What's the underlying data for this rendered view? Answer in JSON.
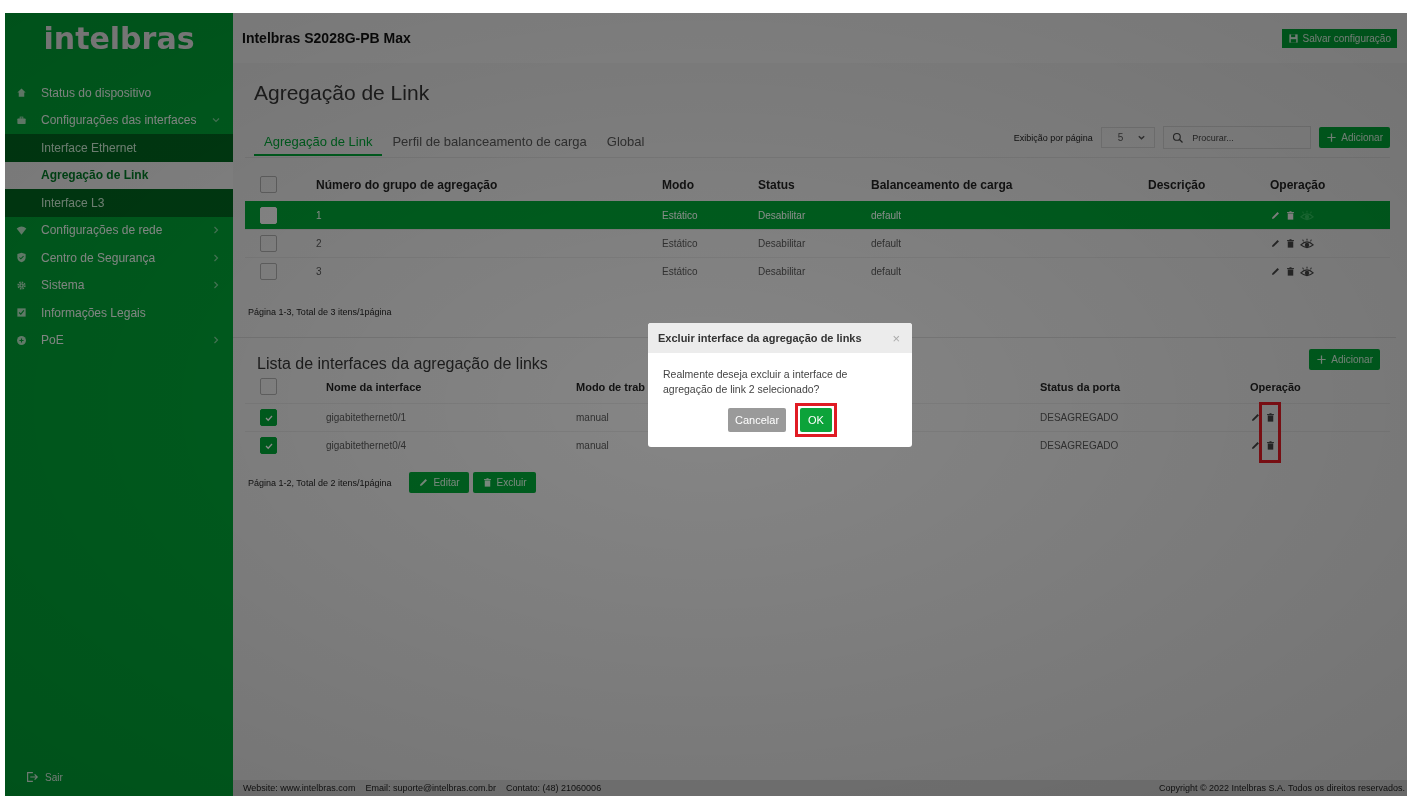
{
  "sidebar": {
    "logo": "intelbras",
    "items": [
      {
        "label": "Status do dispositivo"
      },
      {
        "label": "Configurações das interfaces",
        "expanded": true,
        "children": [
          {
            "label": "Interface Ethernet",
            "selected": false
          },
          {
            "label": "Agregação de Link",
            "selected": true
          },
          {
            "label": "Interface L3",
            "selected": false
          }
        ]
      },
      {
        "label": "Configurações de rede",
        "expanded": false
      },
      {
        "label": "Centro de Segurança",
        "expanded": false
      },
      {
        "label": "Sistema",
        "expanded": false
      },
      {
        "label": "Informações Legais"
      },
      {
        "label": "PoE",
        "expanded": false
      }
    ],
    "logout": "Sair"
  },
  "topbar": {
    "title": "Intelbras S2028G-PB Max",
    "save_button": "Salvar configuração"
  },
  "page_title": "Agregação de Link",
  "tabs": [
    {
      "label": "Agregação de Link",
      "selected": true
    },
    {
      "label": "Perfil de balanceamento de carga",
      "selected": false
    },
    {
      "label": "Global",
      "selected": false
    }
  ],
  "toolbar": {
    "per_page_label": "Exibição por página",
    "per_page": "5",
    "search": {
      "placeholder": "Procurar..."
    },
    "add_button": "Adicionar"
  },
  "groups_table": {
    "columns": [
      "Número do grupo de agregação",
      "Modo",
      "Status",
      "Balanceamento de carga",
      "Descrição",
      "Operação"
    ],
    "all_checked": false,
    "rows": [
      {
        "selected": true,
        "checked": false,
        "cells": [
          "1",
          "Estático",
          "Desabilitar",
          "default",
          ""
        ]
      },
      {
        "selected": false,
        "checked": false,
        "cells": [
          "2",
          "Estático",
          "Desabilitar",
          "default",
          ""
        ]
      },
      {
        "selected": false,
        "checked": false,
        "cells": [
          "3",
          "Estático",
          "Desabilitar",
          "default",
          ""
        ]
      }
    ],
    "pagination": "Página 1-3, Total de 3 itens/1página"
  },
  "interfaces": {
    "title": "Lista de interfaces da agregação de links",
    "add_button": "Adicionar",
    "columns": [
      "Nome da interface",
      "Modo de trab",
      "",
      "Status da porta",
      "Operação"
    ],
    "all_checked": false,
    "delete_highlighted": true,
    "rows": [
      {
        "checked": true,
        "cells": [
          "gigabitethernet0/1",
          "manual",
          "",
          "DESAGREGADO"
        ]
      },
      {
        "checked": true,
        "cells": [
          "gigabitethernet0/4",
          "manual",
          "",
          "DESAGREGADO"
        ]
      }
    ],
    "pagination": "Página 1-2, Total de 2 itens/1página",
    "edit_button": "Editar",
    "delete_button": "Excluir"
  },
  "dialog": {
    "title": "Excluir interface da agregação de links",
    "close": "×",
    "message": "Realmente deseja excluir a interface de agregação de link 2 selecionado?",
    "buttons": [
      {
        "label": "Cancelar",
        "kind": "cancel",
        "highlighted": false
      },
      {
        "label": "OK",
        "kind": "confirm",
        "highlighted": true
      }
    ]
  },
  "footer": {
    "website": "Website: www.intelbras.com",
    "email": "Email: suporte@intelbras.com.br",
    "contact": "Contato: (48) 21060006",
    "copyright": "Copyright © 2022 Intelbras S.A. Todos os direitos reservados."
  }
}
